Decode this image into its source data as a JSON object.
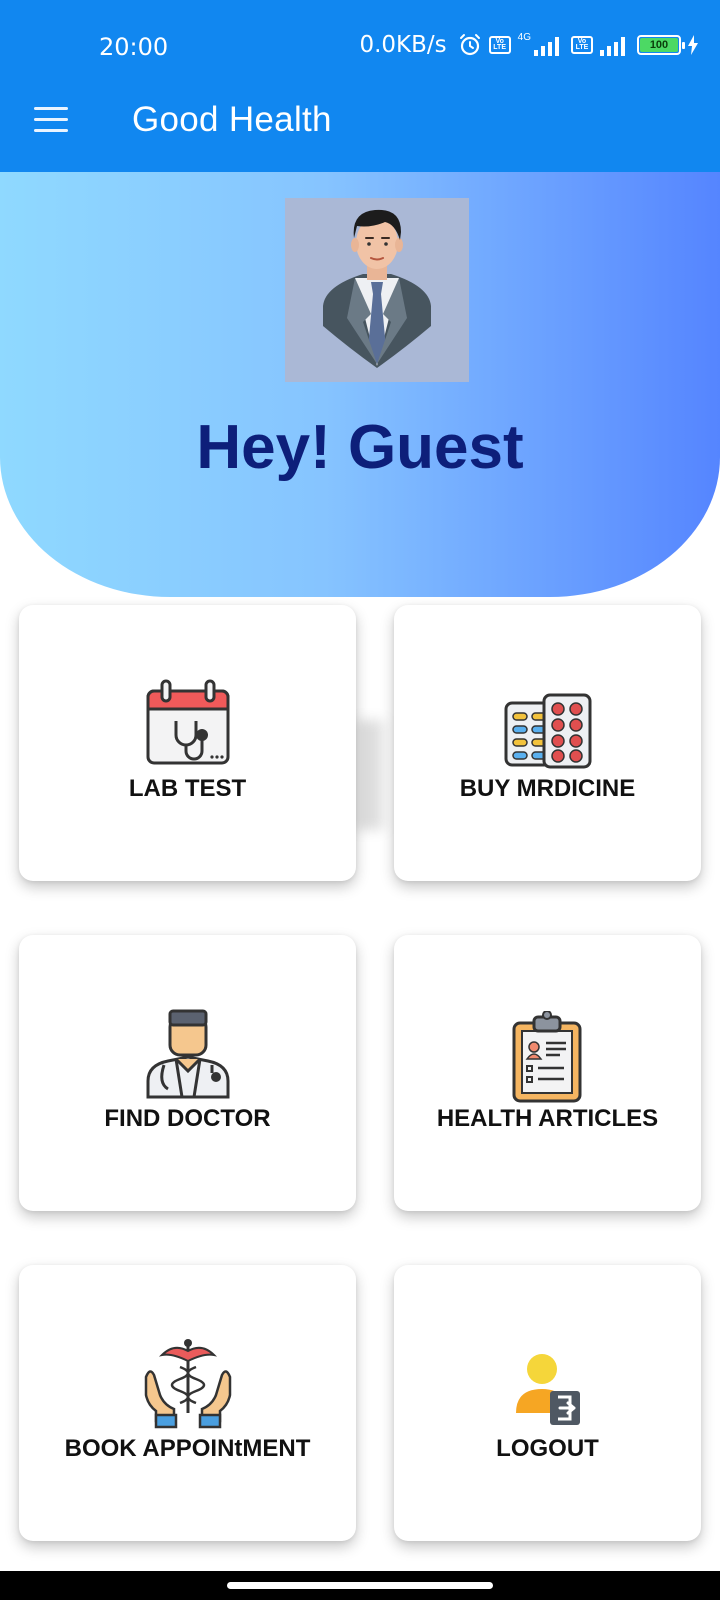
{
  "status_bar": {
    "time": "20:00",
    "net_speed": "0.0KB/s",
    "battery": "100",
    "net_type": "4G",
    "volte": "Vo LTE",
    "icons": [
      "alarm-icon",
      "volte-icon",
      "signal-icon",
      "volte-icon",
      "signal-icon",
      "battery-icon",
      "charging-icon"
    ]
  },
  "app_bar": {
    "title": "Good Health",
    "menu_icon": "hamburger-menu-icon"
  },
  "header": {
    "greeting": "Hey! Guest",
    "avatar": "doctor-avatar"
  },
  "cards": [
    {
      "label": "LAB TEST",
      "icon": "calendar-stethoscope-icon"
    },
    {
      "label": "BUY MRDICINE",
      "icon": "pill-blister-icon"
    },
    {
      "label": "FIND DOCTOR",
      "icon": "doctor-icon"
    },
    {
      "label": "HEALTH ARTICLES",
      "icon": "clipboard-report-icon"
    },
    {
      "label": "BOOK APPOINtMENT",
      "icon": "caduceus-hands-icon"
    },
    {
      "label": "LOGOUT",
      "icon": "user-logout-icon"
    }
  ],
  "colors": {
    "app_bar": "#1187f0",
    "greeting": "#0d1f7a",
    "header_gradient_start": "#8fd9ff",
    "header_gradient_end": "#5585ff"
  }
}
